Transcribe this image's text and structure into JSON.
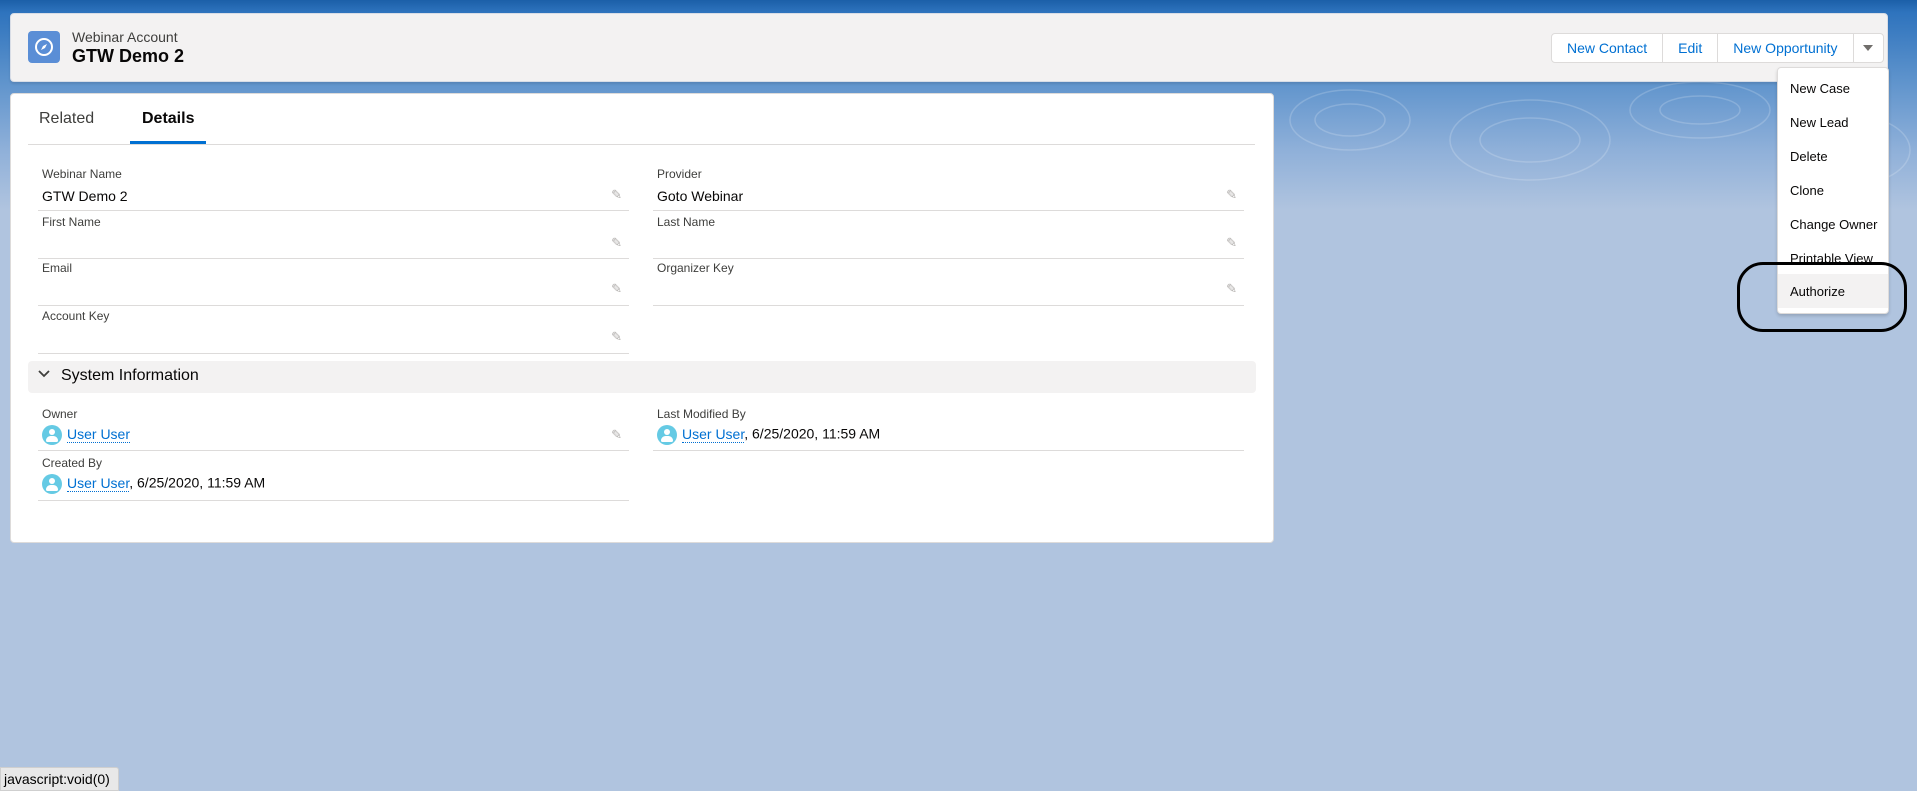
{
  "header": {
    "object_type": "Webinar Account",
    "record_title": "GTW Demo 2",
    "buttons": [
      "New Contact",
      "Edit",
      "New Opportunity"
    ]
  },
  "dropdown_menu": {
    "items": [
      "New Case",
      "New Lead",
      "Delete",
      "Clone",
      "Change Owner",
      "Printable View",
      "Authorize"
    ],
    "highlighted": "Authorize"
  },
  "tabs": [
    "Related",
    "Details"
  ],
  "active_tab": "Details",
  "fields": {
    "webinar_name": {
      "label": "Webinar Name",
      "value": "GTW Demo 2"
    },
    "provider": {
      "label": "Provider",
      "value": "Goto Webinar"
    },
    "first_name": {
      "label": "First Name",
      "value": ""
    },
    "last_name": {
      "label": "Last Name",
      "value": ""
    },
    "email": {
      "label": "Email",
      "value": ""
    },
    "organizer_key": {
      "label": "Organizer Key",
      "value": ""
    },
    "account_key": {
      "label": "Account Key",
      "value": ""
    }
  },
  "system_information": {
    "title": "System Information",
    "owner": {
      "label": "Owner",
      "user": "User User"
    },
    "last_modified_by": {
      "label": "Last Modified By",
      "user": "User User",
      "timestamp": ", 6/25/2020, 11:59 AM"
    },
    "created_by": {
      "label": "Created By",
      "user": "User User",
      "timestamp": ", 6/25/2020, 11:59 AM"
    }
  },
  "status_bar": {
    "text": "javascript:void(0)"
  },
  "colors": {
    "brand": "#0070d2",
    "header_bg": "#f3f2f2",
    "page_bg": "#b0c4df",
    "object_icon": "#5a8ed6"
  }
}
